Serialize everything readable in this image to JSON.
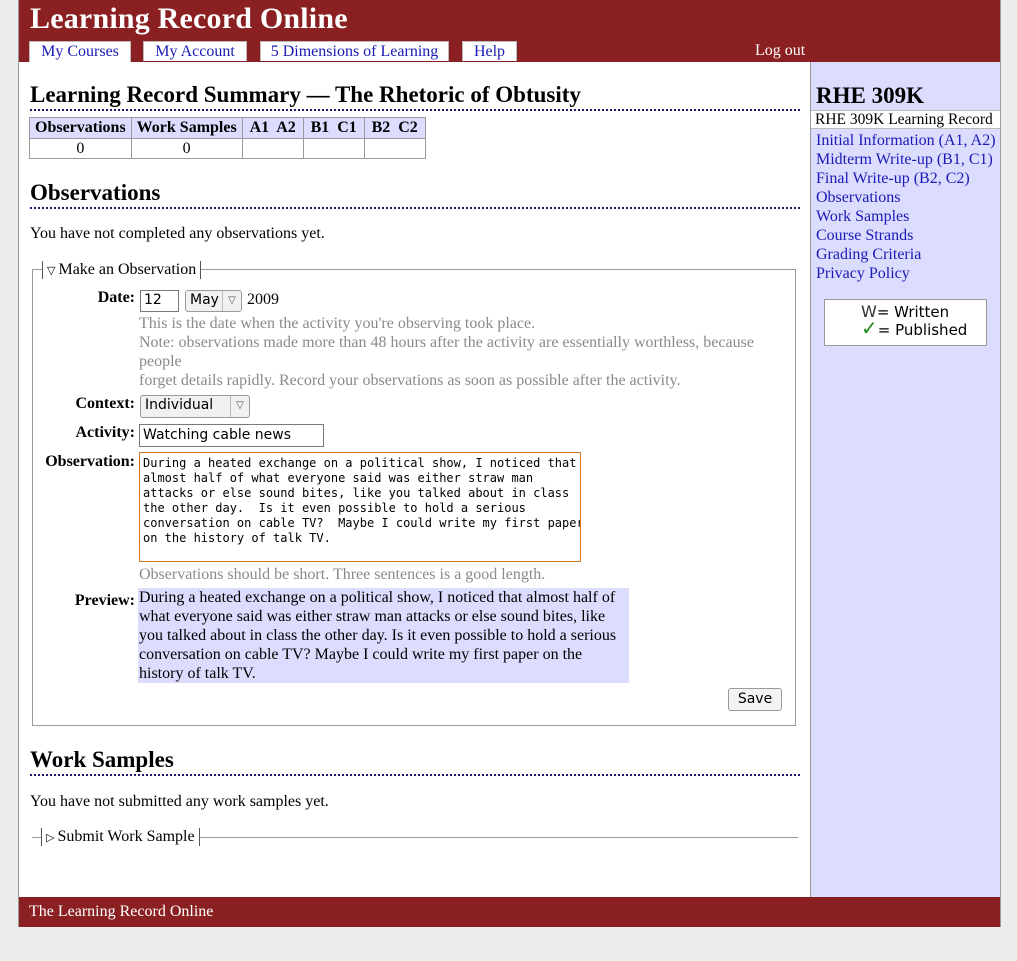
{
  "app": {
    "title": "Learning Record Online"
  },
  "nav": {
    "tabs": [
      {
        "label": "My Courses"
      },
      {
        "label": "My Account"
      },
      {
        "label": "5 Dimensions of Learning"
      },
      {
        "label": "Help"
      }
    ],
    "active_tab": "My Courses",
    "logout_label": "Log out"
  },
  "summary": {
    "title": "Learning Record Summary — The Rhetoric of Obtusity",
    "table": {
      "headers": [
        "Observations",
        "Work Samples",
        "A1  A2",
        "B1  C1",
        "B2  C2"
      ],
      "values": [
        "0",
        "0",
        "",
        "",
        ""
      ]
    }
  },
  "observations": {
    "heading": "Observations",
    "empty_message": "You have not completed any observations yet.",
    "form": {
      "legend": "Make an Observation",
      "date": {
        "label": "Date:",
        "day": "12",
        "month": "May",
        "year": "2009",
        "hint_lines": [
          "This is the date when the activity you're observing took place.",
          "Note: observations made more than 48 hours after the activity are essentially worthless, because people",
          "forget details rapidly. Record your observations as soon as possible after the activity."
        ]
      },
      "context": {
        "label": "Context:",
        "value": "Individual"
      },
      "activity": {
        "label": "Activity:",
        "value": "Watching cable news"
      },
      "observation": {
        "label": "Observation:",
        "value": "During a heated exchange on a political show, I noticed that\nalmost half of what everyone said was either straw man\nattacks or else sound bites, like you talked about in class\nthe other day.  Is it even possible to hold a serious\nconversation on cable TV?  Maybe I could write my first paper\non the history of talk TV.",
        "hint": "Observations should be short. Three sentences is a good length."
      },
      "preview": {
        "label": "Preview:",
        "text": "During a heated exchange on a political show, I noticed that almost half of what everyone said was either straw man attacks or else sound bites, like you talked about in class the other day. Is it even possible to hold a serious conversation on cable TV? Maybe I could write my first paper on the history of talk TV."
      },
      "save_label": "Save"
    }
  },
  "work_samples": {
    "heading": "Work Samples",
    "empty_message": "You have not submitted any work samples yet.",
    "legend": "Submit Work Sample"
  },
  "sidebar": {
    "course_title": "RHE 309K",
    "course_subtitle": "RHE 309K Learning Record",
    "links": [
      {
        "label": "Initial Information (A1, A2)"
      },
      {
        "label": "Midterm Write-up (B1, C1)"
      },
      {
        "label": "Final Write-up (B2, C2)"
      },
      {
        "label": "Observations"
      },
      {
        "label": "Work Samples"
      },
      {
        "label": "Course Strands"
      },
      {
        "label": "Grading Criteria"
      },
      {
        "label": "Privacy Policy"
      }
    ],
    "legend": {
      "written": "= Written",
      "published": "= Published",
      "written_icon": "written-icon",
      "published_icon": "checkmark-icon"
    }
  },
  "footer": {
    "text": "The Learning Record Online"
  },
  "colors": {
    "brand": "#8b2022",
    "sidebar_bg": "#dcdcff",
    "link": "#1a1ab5",
    "textarea_focus": "#d3761b",
    "check": "#1c8a1c"
  }
}
